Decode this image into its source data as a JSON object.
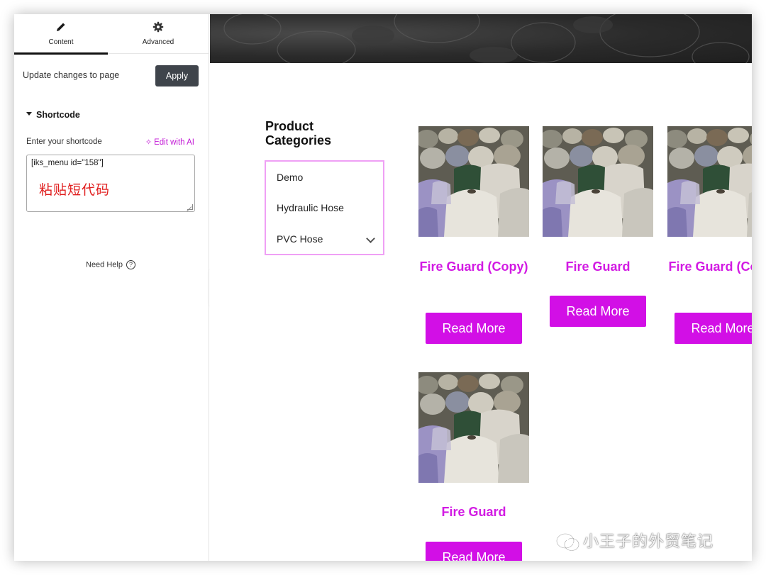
{
  "panel": {
    "tabs": [
      {
        "label": "Content",
        "icon": "pencil-icon",
        "active": true
      },
      {
        "label": "Advanced",
        "icon": "gear-icon",
        "active": false
      }
    ],
    "update_text": "Update changes to page",
    "apply_label": "Apply",
    "section_title": "Shortcode",
    "field_label": "Enter your shortcode",
    "edit_ai_label": "Edit with AI",
    "shortcode_value": "[iks_menu id=\"158\"]",
    "annotation": "粘贴短代码",
    "need_help": "Need Help",
    "accent_color": "#c31ad6"
  },
  "preview": {
    "categories_title": "Product Categories",
    "categories": [
      "Demo",
      "Hydraulic Hose",
      "PVC Hose"
    ],
    "products": [
      {
        "title": "Fire Guard (Copy)",
        "button": "Read More"
      },
      {
        "title": "Fire Guard",
        "button": "Read More"
      },
      {
        "title": "Fire Guard (Copy)",
        "button": "Read More"
      },
      {
        "title": "Fire Guard",
        "button": "Read More"
      }
    ],
    "brand_color": "#d20fe6"
  },
  "watermark": "小王子的外贸笔记"
}
